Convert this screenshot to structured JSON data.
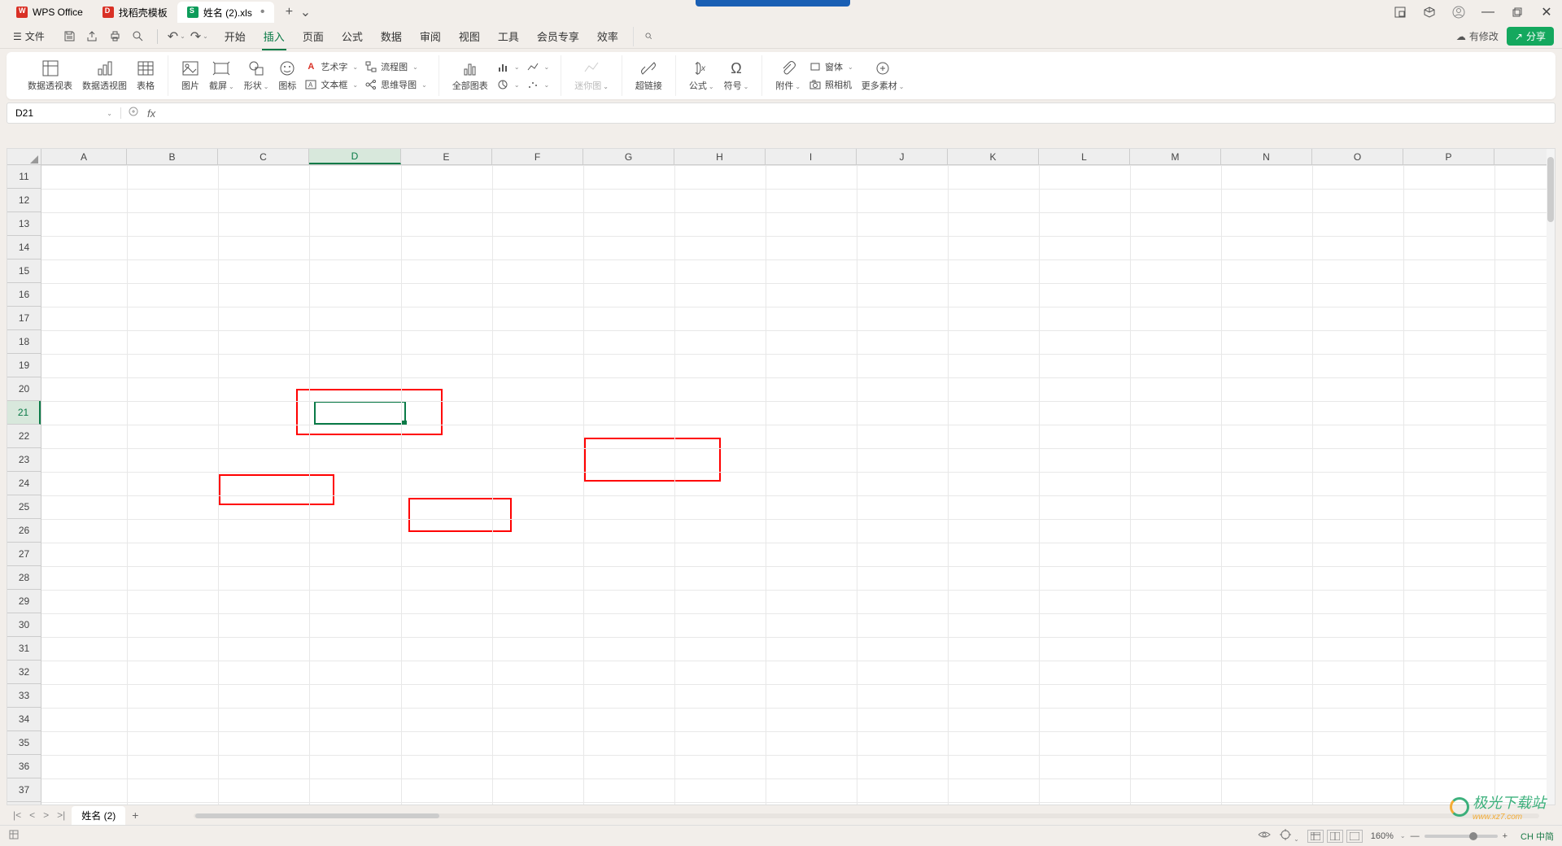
{
  "tabs": {
    "wps": "WPS Office",
    "template": "找稻壳模板",
    "file": "姓名 (2).xls"
  },
  "menu": {
    "file": "文件",
    "items": {
      "start": "开始",
      "insert": "插入",
      "page": "页面",
      "formula": "公式",
      "data": "数据",
      "review": "审阅",
      "view": "视图",
      "tools": "工具",
      "member": "会员专享",
      "eff": "效率"
    },
    "modified": "有修改",
    "share": "分享"
  },
  "ribbon": {
    "pivot_table": "数据透视表",
    "pivot_chart": "数据透视图",
    "table": "表格",
    "picture": "图片",
    "screenshot": "截屏",
    "shape": "形状",
    "icon": "图标",
    "wordart": "艺术字",
    "flowchart": "流程图",
    "textbox": "文本框",
    "mindmap": "思维导图",
    "all_charts": "全部图表",
    "sparkline": "迷你图",
    "hyperlink": "超链接",
    "equation": "公式",
    "symbol": "符号",
    "attachment": "附件",
    "object": "窗体",
    "camera": "照相机",
    "more": "更多素材"
  },
  "namebox": "D21",
  "columns": [
    "A",
    "B",
    "C",
    "D",
    "E",
    "F",
    "G",
    "H",
    "I",
    "J",
    "K",
    "L",
    "M",
    "N",
    "O",
    "P"
  ],
  "first_row": 11,
  "last_row": 37,
  "selected_col": "D",
  "selected_row": 21,
  "sheet": {
    "name": "姓名 (2)"
  },
  "status": {
    "zoom": "160%",
    "ime": "CH 中简"
  },
  "watermark": "极光下载站",
  "watermark_url": "www.xz7.com"
}
